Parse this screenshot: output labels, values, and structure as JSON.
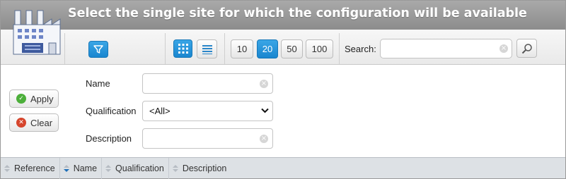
{
  "header": {
    "title": "Select the single site for which the configuration will be available",
    "logo_icon": "factory-icon"
  },
  "toolbar": {
    "filter_icon": "funnel-icon",
    "view_grid_icon": "grid-view-icon",
    "view_list_icon": "list-view-icon",
    "page_sizes": [
      "10",
      "20",
      "50",
      "100"
    ],
    "page_size_selected": "20",
    "search_label": "Search:",
    "search_value": "",
    "search_icon": "magnifier-icon"
  },
  "actions": {
    "apply_label": "Apply",
    "clear_label": "Clear"
  },
  "filters": {
    "name_label": "Name",
    "name_value": "",
    "qualification_label": "Qualification",
    "qualification_value": "<All>",
    "description_label": "Description",
    "description_value": ""
  },
  "columns": [
    {
      "label": "Reference",
      "sort": "none"
    },
    {
      "label": "Name",
      "sort": "ascending"
    },
    {
      "label": "Qualification",
      "sort": "none"
    },
    {
      "label": "Description",
      "sort": "none"
    }
  ],
  "colors": {
    "accent": "#1f8fd6",
    "header_bg": "#9a9a9a",
    "apply_green": "#4caf3a",
    "clear_red": "#d6452c"
  }
}
